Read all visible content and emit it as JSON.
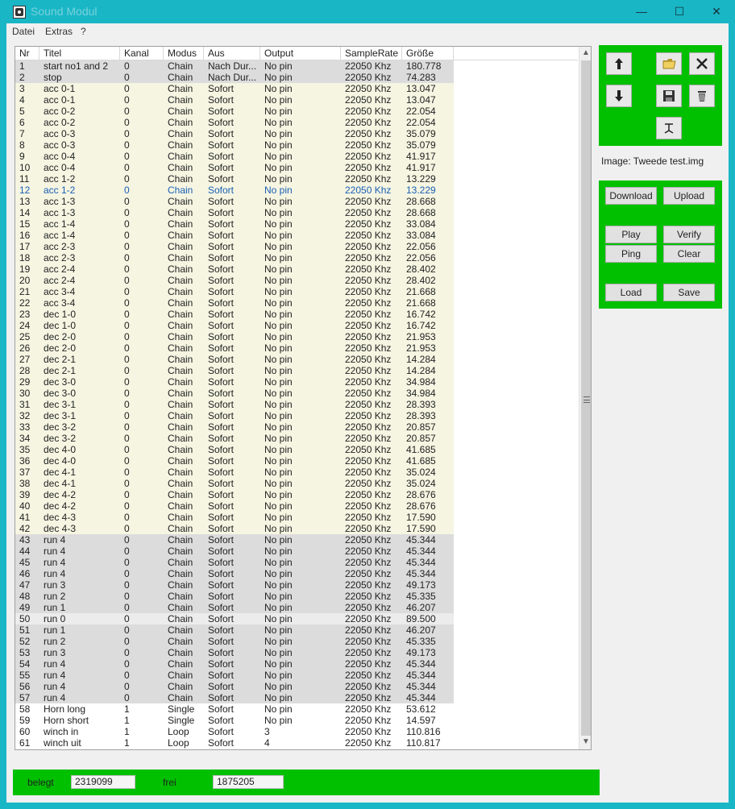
{
  "window": {
    "title": "Sound Modul",
    "controls": {
      "minimize": "—",
      "maximize": "☐",
      "close": "✕"
    }
  },
  "menu": {
    "items": [
      "Datei",
      "Extras",
      "?"
    ]
  },
  "list": {
    "columns": [
      "Nr",
      "Titel",
      "Kanal",
      "Modus",
      "Aus",
      "Output",
      "SampleRate",
      "Größe"
    ],
    "rows": [
      {
        "nr": "1",
        "titel": "start no1 and 2",
        "kanal": "0",
        "modus": "Chain",
        "aus": "Nach Dur...",
        "output": "No pin",
        "rate": "22050 Khz",
        "size": "180.778",
        "bg": "gray"
      },
      {
        "nr": "2",
        "titel": "stop",
        "kanal": "0",
        "modus": "Chain",
        "aus": "Nach Dur...",
        "output": "No pin",
        "rate": "22050 Khz",
        "size": "74.283",
        "bg": "gray"
      },
      {
        "nr": "3",
        "titel": "acc 0-1",
        "kanal": "0",
        "modus": "Chain",
        "aus": "Sofort",
        "output": "No pin",
        "rate": "22050 Khz",
        "size": "13.047",
        "bg": "cream"
      },
      {
        "nr": "4",
        "titel": "acc 0-1",
        "kanal": "0",
        "modus": "Chain",
        "aus": "Sofort",
        "output": "No pin",
        "rate": "22050 Khz",
        "size": "13.047",
        "bg": "cream"
      },
      {
        "nr": "5",
        "titel": "acc 0-2",
        "kanal": "0",
        "modus": "Chain",
        "aus": "Sofort",
        "output": "No pin",
        "rate": "22050 Khz",
        "size": "22.054",
        "bg": "cream"
      },
      {
        "nr": "6",
        "titel": "acc 0-2",
        "kanal": "0",
        "modus": "Chain",
        "aus": "Sofort",
        "output": "No pin",
        "rate": "22050 Khz",
        "size": "22.054",
        "bg": "cream"
      },
      {
        "nr": "7",
        "titel": "acc 0-3",
        "kanal": "0",
        "modus": "Chain",
        "aus": "Sofort",
        "output": "No pin",
        "rate": "22050 Khz",
        "size": "35.079",
        "bg": "cream"
      },
      {
        "nr": "8",
        "titel": "acc 0-3",
        "kanal": "0",
        "modus": "Chain",
        "aus": "Sofort",
        "output": "No pin",
        "rate": "22050 Khz",
        "size": "35.079",
        "bg": "cream"
      },
      {
        "nr": "9",
        "titel": "acc 0-4",
        "kanal": "0",
        "modus": "Chain",
        "aus": "Sofort",
        "output": "No pin",
        "rate": "22050 Khz",
        "size": "41.917",
        "bg": "cream"
      },
      {
        "nr": "10",
        "titel": "acc 0-4",
        "kanal": "0",
        "modus": "Chain",
        "aus": "Sofort",
        "output": "No pin",
        "rate": "22050 Khz",
        "size": "41.917",
        "bg": "cream"
      },
      {
        "nr": "11",
        "titel": "acc 1-2",
        "kanal": "0",
        "modus": "Chain",
        "aus": "Sofort",
        "output": "No pin",
        "rate": "22050 Khz",
        "size": "13.229",
        "bg": "cream"
      },
      {
        "nr": "12",
        "titel": "acc 1-2",
        "kanal": "0",
        "modus": "Chain",
        "aus": "Sofort",
        "output": "No pin",
        "rate": "22050 Khz",
        "size": "13.229",
        "bg": "cream",
        "selected": true
      },
      {
        "nr": "13",
        "titel": "acc 1-3",
        "kanal": "0",
        "modus": "Chain",
        "aus": "Sofort",
        "output": "No pin",
        "rate": "22050 Khz",
        "size": "28.668",
        "bg": "cream"
      },
      {
        "nr": "14",
        "titel": "acc 1-3",
        "kanal": "0",
        "modus": "Chain",
        "aus": "Sofort",
        "output": "No pin",
        "rate": "22050 Khz",
        "size": "28.668",
        "bg": "cream"
      },
      {
        "nr": "15",
        "titel": "acc 1-4",
        "kanal": "0",
        "modus": "Chain",
        "aus": "Sofort",
        "output": "No pin",
        "rate": "22050 Khz",
        "size": "33.084",
        "bg": "cream"
      },
      {
        "nr": "16",
        "titel": "acc 1-4",
        "kanal": "0",
        "modus": "Chain",
        "aus": "Sofort",
        "output": "No pin",
        "rate": "22050 Khz",
        "size": "33.084",
        "bg": "cream"
      },
      {
        "nr": "17",
        "titel": "acc 2-3",
        "kanal": "0",
        "modus": "Chain",
        "aus": "Sofort",
        "output": "No pin",
        "rate": "22050 Khz",
        "size": "22.056",
        "bg": "cream"
      },
      {
        "nr": "18",
        "titel": "acc 2-3",
        "kanal": "0",
        "modus": "Chain",
        "aus": "Sofort",
        "output": "No pin",
        "rate": "22050 Khz",
        "size": "22.056",
        "bg": "cream"
      },
      {
        "nr": "19",
        "titel": "acc 2-4",
        "kanal": "0",
        "modus": "Chain",
        "aus": "Sofort",
        "output": "No pin",
        "rate": "22050 Khz",
        "size": "28.402",
        "bg": "cream"
      },
      {
        "nr": "20",
        "titel": "acc 2-4",
        "kanal": "0",
        "modus": "Chain",
        "aus": "Sofort",
        "output": "No pin",
        "rate": "22050 Khz",
        "size": "28.402",
        "bg": "cream"
      },
      {
        "nr": "21",
        "titel": "acc 3-4",
        "kanal": "0",
        "modus": "Chain",
        "aus": "Sofort",
        "output": "No pin",
        "rate": "22050 Khz",
        "size": "21.668",
        "bg": "cream"
      },
      {
        "nr": "22",
        "titel": "acc 3-4",
        "kanal": "0",
        "modus": "Chain",
        "aus": "Sofort",
        "output": "No pin",
        "rate": "22050 Khz",
        "size": "21.668",
        "bg": "cream"
      },
      {
        "nr": "23",
        "titel": "dec 1-0",
        "kanal": "0",
        "modus": "Chain",
        "aus": "Sofort",
        "output": "No pin",
        "rate": "22050 Khz",
        "size": "16.742",
        "bg": "cream"
      },
      {
        "nr": "24",
        "titel": "dec 1-0",
        "kanal": "0",
        "modus": "Chain",
        "aus": "Sofort",
        "output": "No pin",
        "rate": "22050 Khz",
        "size": "16.742",
        "bg": "cream"
      },
      {
        "nr": "25",
        "titel": "dec 2-0",
        "kanal": "0",
        "modus": "Chain",
        "aus": "Sofort",
        "output": "No pin",
        "rate": "22050 Khz",
        "size": "21.953",
        "bg": "cream"
      },
      {
        "nr": "26",
        "titel": "dec 2-0",
        "kanal": "0",
        "modus": "Chain",
        "aus": "Sofort",
        "output": "No pin",
        "rate": "22050 Khz",
        "size": "21.953",
        "bg": "cream"
      },
      {
        "nr": "27",
        "titel": "dec 2-1",
        "kanal": "0",
        "modus": "Chain",
        "aus": "Sofort",
        "output": "No pin",
        "rate": "22050 Khz",
        "size": "14.284",
        "bg": "cream"
      },
      {
        "nr": "28",
        "titel": "dec 2-1",
        "kanal": "0",
        "modus": "Chain",
        "aus": "Sofort",
        "output": "No pin",
        "rate": "22050 Khz",
        "size": "14.284",
        "bg": "cream"
      },
      {
        "nr": "29",
        "titel": "dec 3-0",
        "kanal": "0",
        "modus": "Chain",
        "aus": "Sofort",
        "output": "No pin",
        "rate": "22050 Khz",
        "size": "34.984",
        "bg": "cream"
      },
      {
        "nr": "30",
        "titel": "dec 3-0",
        "kanal": "0",
        "modus": "Chain",
        "aus": "Sofort",
        "output": "No pin",
        "rate": "22050 Khz",
        "size": "34.984",
        "bg": "cream"
      },
      {
        "nr": "31",
        "titel": "dec 3-1",
        "kanal": "0",
        "modus": "Chain",
        "aus": "Sofort",
        "output": "No pin",
        "rate": "22050 Khz",
        "size": "28.393",
        "bg": "cream"
      },
      {
        "nr": "32",
        "titel": "dec 3-1",
        "kanal": "0",
        "modus": "Chain",
        "aus": "Sofort",
        "output": "No pin",
        "rate": "22050 Khz",
        "size": "28.393",
        "bg": "cream"
      },
      {
        "nr": "33",
        "titel": "dec 3-2",
        "kanal": "0",
        "modus": "Chain",
        "aus": "Sofort",
        "output": "No pin",
        "rate": "22050 Khz",
        "size": "20.857",
        "bg": "cream"
      },
      {
        "nr": "34",
        "titel": "dec 3-2",
        "kanal": "0",
        "modus": "Chain",
        "aus": "Sofort",
        "output": "No pin",
        "rate": "22050 Khz",
        "size": "20.857",
        "bg": "cream"
      },
      {
        "nr": "35",
        "titel": "dec 4-0",
        "kanal": "0",
        "modus": "Chain",
        "aus": "Sofort",
        "output": "No pin",
        "rate": "22050 Khz",
        "size": "41.685",
        "bg": "cream"
      },
      {
        "nr": "36",
        "titel": "dec 4-0",
        "kanal": "0",
        "modus": "Chain",
        "aus": "Sofort",
        "output": "No pin",
        "rate": "22050 Khz",
        "size": "41.685",
        "bg": "cream"
      },
      {
        "nr": "37",
        "titel": "dec 4-1",
        "kanal": "0",
        "modus": "Chain",
        "aus": "Sofort",
        "output": "No pin",
        "rate": "22050 Khz",
        "size": "35.024",
        "bg": "cream"
      },
      {
        "nr": "38",
        "titel": "dec 4-1",
        "kanal": "0",
        "modus": "Chain",
        "aus": "Sofort",
        "output": "No pin",
        "rate": "22050 Khz",
        "size": "35.024",
        "bg": "cream"
      },
      {
        "nr": "39",
        "titel": "dec 4-2",
        "kanal": "0",
        "modus": "Chain",
        "aus": "Sofort",
        "output": "No pin",
        "rate": "22050 Khz",
        "size": "28.676",
        "bg": "cream"
      },
      {
        "nr": "40",
        "titel": "dec 4-2",
        "kanal": "0",
        "modus": "Chain",
        "aus": "Sofort",
        "output": "No pin",
        "rate": "22050 Khz",
        "size": "28.676",
        "bg": "cream"
      },
      {
        "nr": "41",
        "titel": "dec 4-3",
        "kanal": "0",
        "modus": "Chain",
        "aus": "Sofort",
        "output": "No pin",
        "rate": "22050 Khz",
        "size": "17.590",
        "bg": "cream"
      },
      {
        "nr": "42",
        "titel": "dec 4-3",
        "kanal": "0",
        "modus": "Chain",
        "aus": "Sofort",
        "output": "No pin",
        "rate": "22050 Khz",
        "size": "17.590",
        "bg": "cream"
      },
      {
        "nr": "43",
        "titel": "run 4",
        "kanal": "0",
        "modus": "Chain",
        "aus": "Sofort",
        "output": "No pin",
        "rate": "22050 Khz",
        "size": "45.344",
        "bg": "gray"
      },
      {
        "nr": "44",
        "titel": "run 4",
        "kanal": "0",
        "modus": "Chain",
        "aus": "Sofort",
        "output": "No pin",
        "rate": "22050 Khz",
        "size": "45.344",
        "bg": "gray"
      },
      {
        "nr": "45",
        "titel": "run 4",
        "kanal": "0",
        "modus": "Chain",
        "aus": "Sofort",
        "output": "No pin",
        "rate": "22050 Khz",
        "size": "45.344",
        "bg": "gray"
      },
      {
        "nr": "46",
        "titel": "run 4",
        "kanal": "0",
        "modus": "Chain",
        "aus": "Sofort",
        "output": "No pin",
        "rate": "22050 Khz",
        "size": "45.344",
        "bg": "gray"
      },
      {
        "nr": "47",
        "titel": "run 3",
        "kanal": "0",
        "modus": "Chain",
        "aus": "Sofort",
        "output": "No pin",
        "rate": "22050 Khz",
        "size": "49.173",
        "bg": "gray"
      },
      {
        "nr": "48",
        "titel": "run 2",
        "kanal": "0",
        "modus": "Chain",
        "aus": "Sofort",
        "output": "No pin",
        "rate": "22050 Khz",
        "size": "45.335",
        "bg": "gray"
      },
      {
        "nr": "49",
        "titel": "run 1",
        "kanal": "0",
        "modus": "Chain",
        "aus": "Sofort",
        "output": "No pin",
        "rate": "22050 Khz",
        "size": "46.207",
        "bg": "gray"
      },
      {
        "nr": "50",
        "titel": "run 0",
        "kanal": "0",
        "modus": "Chain",
        "aus": "Sofort",
        "output": "No pin",
        "rate": "22050 Khz",
        "size": "89.500",
        "bg": "light"
      },
      {
        "nr": "51",
        "titel": "run 1",
        "kanal": "0",
        "modus": "Chain",
        "aus": "Sofort",
        "output": "No pin",
        "rate": "22050 Khz",
        "size": "46.207",
        "bg": "gray"
      },
      {
        "nr": "52",
        "titel": "run 2",
        "kanal": "0",
        "modus": "Chain",
        "aus": "Sofort",
        "output": "No pin",
        "rate": "22050 Khz",
        "size": "45.335",
        "bg": "gray"
      },
      {
        "nr": "53",
        "titel": "run 3",
        "kanal": "0",
        "modus": "Chain",
        "aus": "Sofort",
        "output": "No pin",
        "rate": "22050 Khz",
        "size": "49.173",
        "bg": "gray"
      },
      {
        "nr": "54",
        "titel": "run 4",
        "kanal": "0",
        "modus": "Chain",
        "aus": "Sofort",
        "output": "No pin",
        "rate": "22050 Khz",
        "size": "45.344",
        "bg": "gray"
      },
      {
        "nr": "55",
        "titel": "run 4",
        "kanal": "0",
        "modus": "Chain",
        "aus": "Sofort",
        "output": "No pin",
        "rate": "22050 Khz",
        "size": "45.344",
        "bg": "gray"
      },
      {
        "nr": "56",
        "titel": "run 4",
        "kanal": "0",
        "modus": "Chain",
        "aus": "Sofort",
        "output": "No pin",
        "rate": "22050 Khz",
        "size": "45.344",
        "bg": "gray"
      },
      {
        "nr": "57",
        "titel": "run 4",
        "kanal": "0",
        "modus": "Chain",
        "aus": "Sofort",
        "output": "No pin",
        "rate": "22050 Khz",
        "size": "45.344",
        "bg": "gray"
      },
      {
        "nr": "58",
        "titel": "Horn long",
        "kanal": "1",
        "modus": "Single",
        "aus": "Sofort",
        "output": "No pin",
        "rate": "22050 Khz",
        "size": "53.612",
        "bg": "white"
      },
      {
        "nr": "59",
        "titel": "Horn short",
        "kanal": "1",
        "modus": "Single",
        "aus": "Sofort",
        "output": "No pin",
        "rate": "22050 Khz",
        "size": "14.597",
        "bg": "white"
      },
      {
        "nr": "60",
        "titel": "winch in",
        "kanal": "1",
        "modus": "Loop",
        "aus": "Sofort",
        "output": "3",
        "rate": "22050 Khz",
        "size": "110.816",
        "bg": "white"
      },
      {
        "nr": "61",
        "titel": "winch uit",
        "kanal": "1",
        "modus": "Loop",
        "aus": "Sofort",
        "output": "4",
        "rate": "22050 Khz",
        "size": "110.817",
        "bg": "white"
      }
    ]
  },
  "tools": {
    "icons": [
      "arrow-up-icon",
      "arrow-down-icon",
      "folder-open-icon",
      "save-icon",
      "close-icon",
      "trash-icon",
      "tool-icon"
    ]
  },
  "image_label": "Image: Tweede test.img",
  "commands": {
    "download": "Download",
    "upload": "Upload",
    "play": "Play",
    "verify": "Verify",
    "ping": "Ping",
    "clear": "Clear",
    "load": "Load",
    "save": "Save"
  },
  "status": {
    "used_label": "belegt",
    "used_value": "2319099",
    "free_label": "frei",
    "free_value": "1875205"
  },
  "colors": {
    "titlebar": "#19b6c6",
    "panel_green": "#00c000",
    "row_gray": "#dcdcdc",
    "row_cream": "#f5f5e2",
    "selected_text": "#1a5fb4"
  }
}
